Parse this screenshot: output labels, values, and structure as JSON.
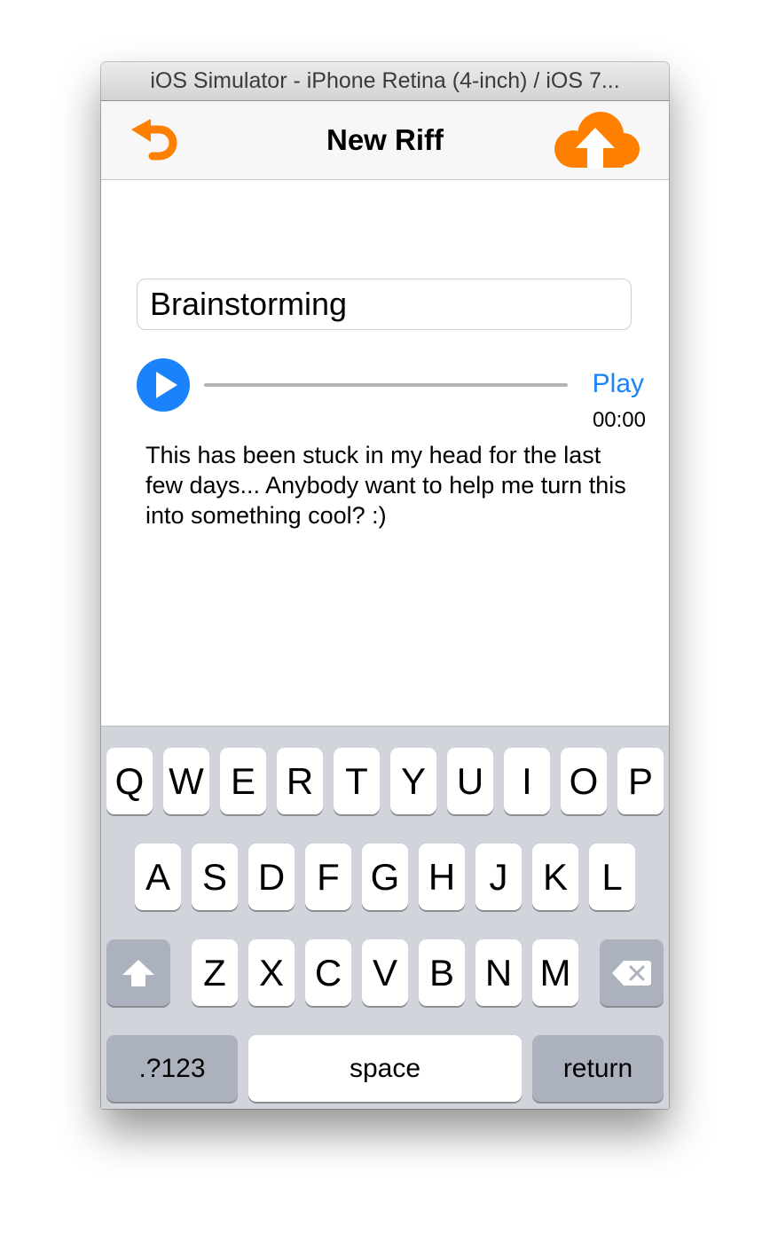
{
  "window": {
    "title": "iOS Simulator - iPhone Retina (4-inch) / iOS 7..."
  },
  "navbar": {
    "title": "New Riff",
    "undo_icon": "undo-arrow-icon",
    "upload_icon": "cloud-upload-icon",
    "accent_color": "#ff7f00"
  },
  "riff": {
    "title_value": "Brainstorming",
    "play_label": "Play",
    "time": "00:00",
    "description": "This has been stuck in my head for the last few days... Anybody want to help me turn this into something cool? :)",
    "progress": 0
  },
  "keyboard": {
    "row1": [
      "Q",
      "W",
      "E",
      "R",
      "T",
      "Y",
      "U",
      "I",
      "O",
      "P"
    ],
    "row2": [
      "A",
      "S",
      "D",
      "F",
      "G",
      "H",
      "J",
      "K",
      "L"
    ],
    "row3": [
      "Z",
      "X",
      "C",
      "V",
      "B",
      "N",
      "M"
    ],
    "shift_icon": "shift-arrow-icon",
    "delete_icon": "backspace-icon",
    "numbers_label": ".?123",
    "space_label": "space",
    "return_label": "return"
  }
}
